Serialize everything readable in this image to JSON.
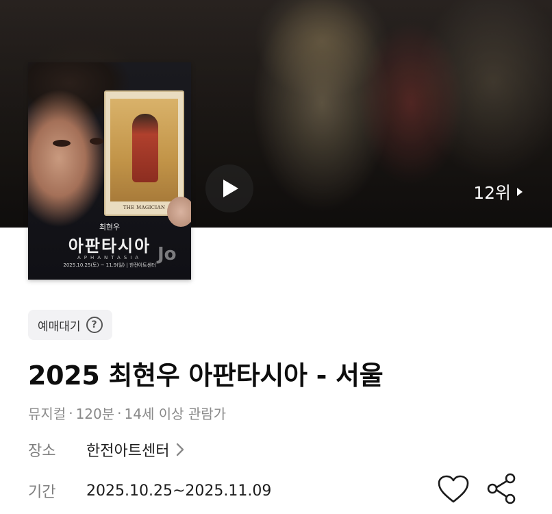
{
  "hero": {
    "rank_text": "12위",
    "play_icon": "play-icon",
    "rank_icon": "caret-right-icon"
  },
  "poster": {
    "subtitle": "최현우",
    "title": "아판타시아",
    "english": "APHANTASIA",
    "info": "2025.10.25(토) ~ 11.9(일) | 한전아트센터",
    "card_label": "THE MAGICIAN",
    "watermark": "Jo"
  },
  "status": {
    "label": "예매대기",
    "icon": "question-circle-icon"
  },
  "title": "2025 최현우 아판타시아 - 서울",
  "meta": {
    "genre": "뮤지컬",
    "runtime": "120분",
    "rating": "14세 이상 관람가",
    "separator": "·"
  },
  "venue": {
    "label": "장소",
    "value": "한전아트센터",
    "icon": "chevron-right-icon"
  },
  "period": {
    "label": "기간",
    "value": "2025.10.25~2025.11.09"
  },
  "actions": {
    "like_icon": "heart-icon",
    "share_icon": "share-icon"
  },
  "colors": {
    "text_primary": "#0d0d0d",
    "text_secondary": "#8a8a8a",
    "badge_bg": "#f2f2f4"
  }
}
